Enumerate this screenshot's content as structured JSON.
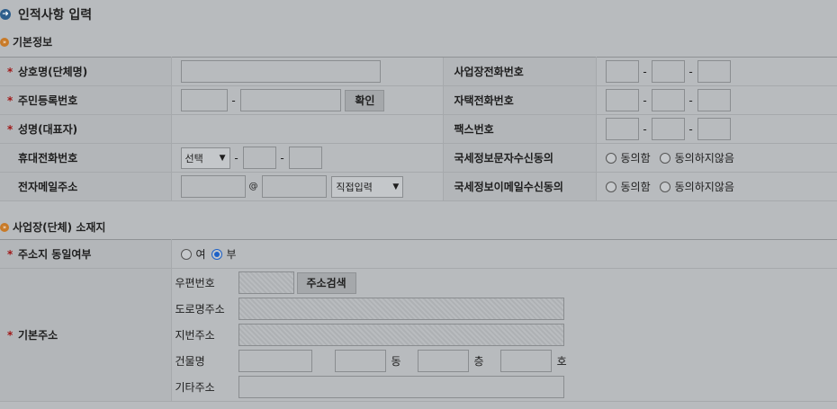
{
  "page": {
    "title": "인적사항 입력"
  },
  "sections": {
    "basic": "기본정보",
    "address": "사업장(단체) 소재지"
  },
  "basic": {
    "business_name": {
      "label": "상호명(단체명)",
      "required": true,
      "value": ""
    },
    "resident_no": {
      "label": "주민등록번호",
      "required": true,
      "confirm_label": "확인"
    },
    "rep_name": {
      "label": "성명(대표자)",
      "required": true,
      "value": ""
    },
    "mobile": {
      "label": "휴대전화번호",
      "required": false,
      "carrier_selected": "선택"
    },
    "email": {
      "label": "전자메일주소",
      "required": false,
      "at": "@",
      "domain_selected": "직접입력"
    },
    "biz_phone": {
      "label": "사업장전화번호"
    },
    "home_phone": {
      "label": "자택전화번호"
    },
    "fax": {
      "label": "팩스번호"
    },
    "sms_consent": {
      "label": "국세정보문자수신동의",
      "agree": "동의함",
      "disagree": "동의하지않음"
    },
    "email_consent": {
      "label": "국세정보이메일수신동의",
      "agree": "동의함",
      "disagree": "동의하지않음"
    },
    "dash": "-"
  },
  "address": {
    "same_address": {
      "label": "주소지 동일여부",
      "yes": "여",
      "no": "부",
      "selected": "no"
    },
    "base_address": {
      "label": "기본주소",
      "postcode_label": "우편번호",
      "search_button": "주소검색",
      "road_label": "도로명주소",
      "jibun_label": "지번주소",
      "building_label": "건물명",
      "dong_unit": "동",
      "floor_unit": "층",
      "ho_unit": "호",
      "etc_label": "기타주소"
    }
  },
  "colors": {
    "required": "#a01818",
    "radio_selected": "#1e62c8",
    "title_icon": "#2e5e8c",
    "section_icon": "#c87a28"
  }
}
